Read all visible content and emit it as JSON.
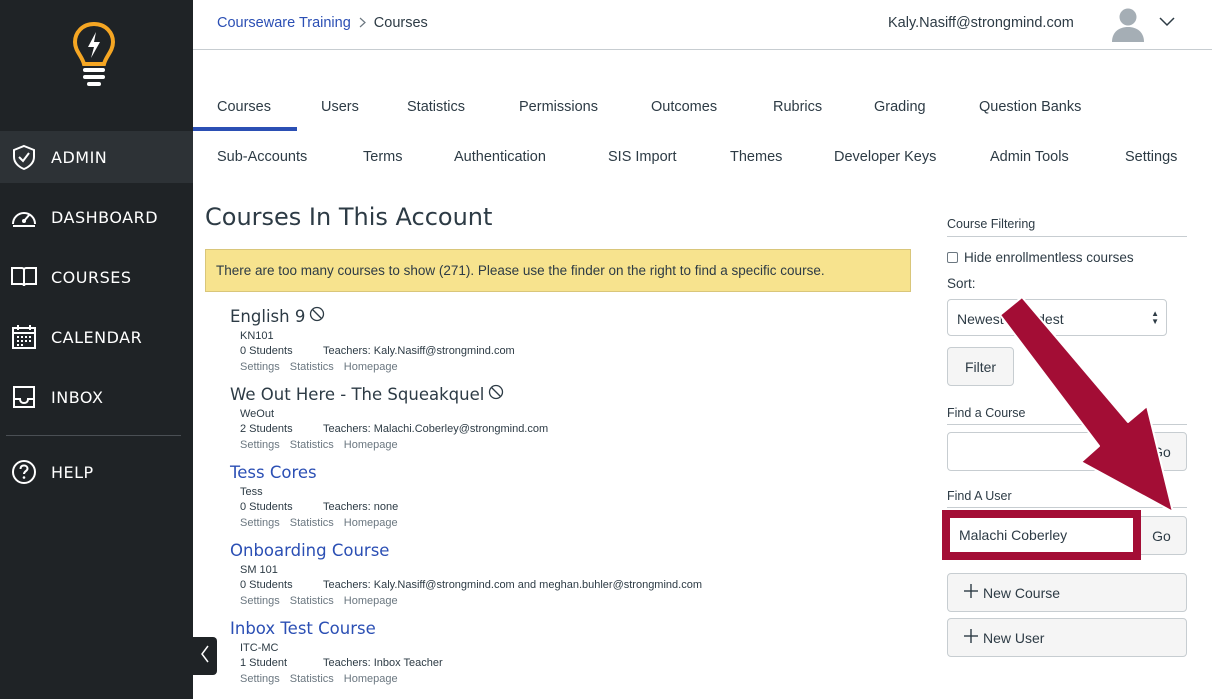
{
  "sidebar": {
    "logo": "lightbulb-logo",
    "items": [
      {
        "label": "ADMIN",
        "icon": "shield-icon",
        "active": true
      },
      {
        "label": "DASHBOARD",
        "icon": "speedometer-icon",
        "active": false
      },
      {
        "label": "COURSES",
        "icon": "book-icon",
        "active": false
      },
      {
        "label": "CALENDAR",
        "icon": "calendar-icon",
        "active": false
      },
      {
        "label": "INBOX",
        "icon": "inbox-icon",
        "active": false
      },
      {
        "label": "HELP",
        "icon": "question-icon",
        "active": false
      }
    ],
    "colors": {
      "background": "#1f2326",
      "active": "#2d3236",
      "logo": "#f5a623"
    }
  },
  "header": {
    "breadcrumb": {
      "parent": "Courseware Training",
      "current": "Courses"
    },
    "user_email": "Kaly.Nasiff@strongmind.com"
  },
  "tabs": {
    "row1": [
      "Courses",
      "Users",
      "Statistics",
      "Permissions",
      "Outcomes",
      "Rubrics",
      "Grading",
      "Question Banks"
    ],
    "row2": [
      "Sub-Accounts",
      "Terms",
      "Authentication",
      "SIS Import",
      "Themes",
      "Developer Keys",
      "Admin Tools",
      "Settings"
    ],
    "active": "Courses"
  },
  "main": {
    "title": "Courses In This Account",
    "alert": "There are too many courses to show (271). Please use the finder on the right to find a specific course.",
    "courses": [
      {
        "name": "English 9",
        "code": "KN101",
        "students": "0 Students",
        "teachers": "Teachers: Kaly.Nasiff@strongmind.com",
        "unpublished": true
      },
      {
        "name": "We Out Here - The Squeakquel",
        "code": "WeOut",
        "students": "2 Students",
        "teachers": "Teachers: Malachi.Coberley@strongmind.com",
        "unpublished": true
      },
      {
        "name": "Tess Cores",
        "code": "Tess",
        "students": "0 Students",
        "teachers": "Teachers: none",
        "unpublished": false
      },
      {
        "name": "Onboarding Course",
        "code": "SM 101",
        "students": "0 Students",
        "teachers": "Teachers: Kaly.Nasiff@strongmind.com and meghan.buhler@strongmind.com",
        "unpublished": false
      },
      {
        "name": "Inbox Test Course",
        "code": "ITC-MC",
        "students": "1 Student",
        "teachers": "Teachers: Inbox Teacher",
        "unpublished": false
      }
    ],
    "course_links": [
      "Settings",
      "Statistics",
      "Homepage"
    ]
  },
  "filter_panel": {
    "heading": "Course Filtering",
    "hide_enrollmentless_label": "Hide enrollmentless courses",
    "hide_enrollmentless_checked": false,
    "sort_label": "Sort:",
    "sort_value": "Newest to Oldest",
    "filter_button": "Filter",
    "find_course_heading": "Find a Course",
    "find_course_value": "",
    "go_label": "Go",
    "find_user_heading": "Find A User",
    "find_user_value": "Malachi Coberley",
    "new_course_button": "New Course",
    "new_user_button": "New User"
  },
  "annotation": {
    "color": "#a30d35"
  },
  "colors": {
    "link": "#2b4fb4",
    "alert_bg": "#f7e38e",
    "text": "#2d3b45"
  }
}
